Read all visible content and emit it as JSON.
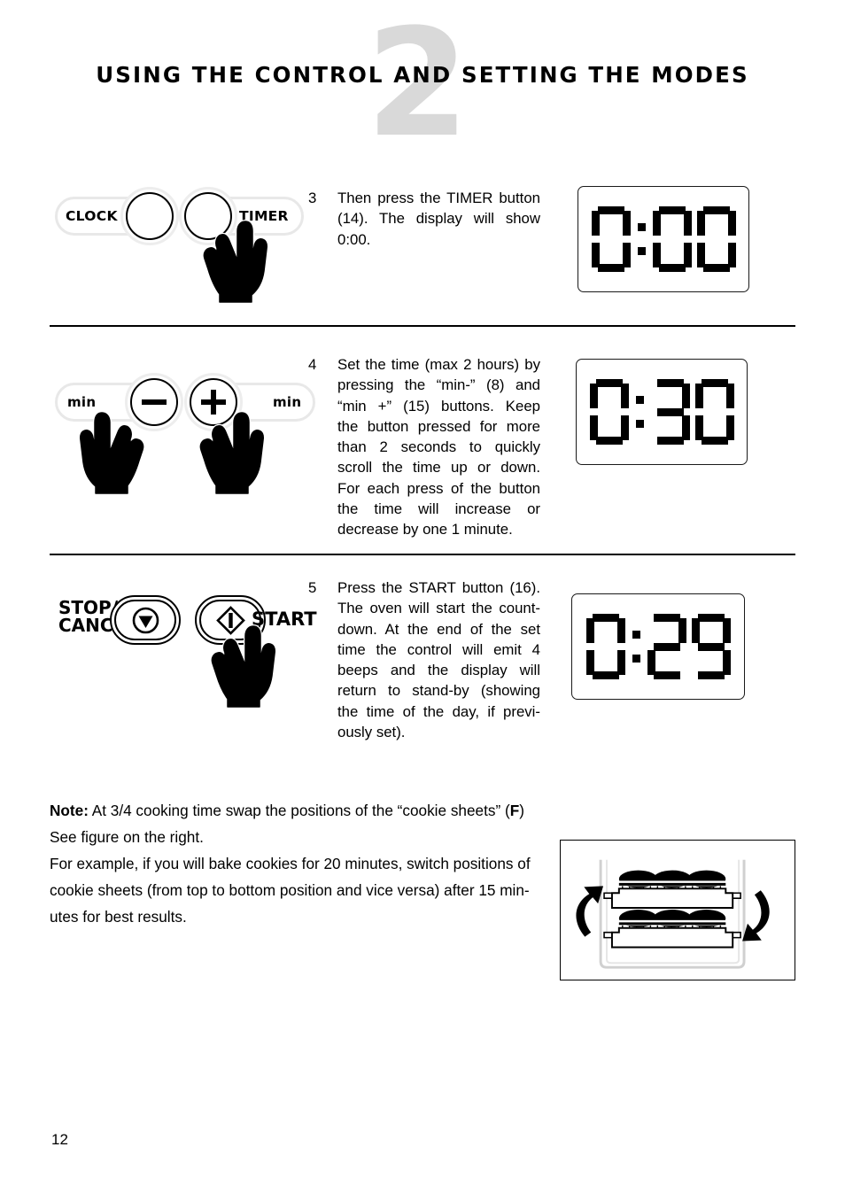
{
  "page": {
    "chapter_number": "2",
    "title": "USING THE CONTROL AND SETTING THE MODES",
    "page_number": "12"
  },
  "steps": [
    {
      "number": "3",
      "lines": [
        "Then press the TIMER button",
        "(14). The display will show",
        "0:00."
      ],
      "display": "0:00",
      "controls": {
        "left_label": "CLOCK",
        "right_label": "TIMER"
      }
    },
    {
      "number": "4",
      "lines": [
        "Set the time (max 2 hours) by",
        "pressing the “min-” (8) and",
        "“min +” (15) buttons. Keep",
        "the button pressed for more",
        "than 2 seconds to quickly",
        "scroll the time up or down.",
        "For each press of the button",
        "the time will increase or",
        "decrease by one 1 minute."
      ],
      "display": "0:30",
      "controls": {
        "left_label": "min",
        "left_glyph": "minus-icon",
        "right_label": "min",
        "right_glyph": "plus-icon"
      }
    },
    {
      "number": "5",
      "lines": [
        "Press the START button (16).",
        "The oven will start the count-",
        "down. At the end of the set",
        "time the control will emit 4",
        "beeps and the display will",
        "return to stand-by (showing",
        "the time of the day, if previ-",
        "ously set)."
      ],
      "display": "0:29",
      "controls": {
        "left_label_line1": "STOP/",
        "left_label_line2": "CANCEL",
        "left_glyph": "stop-triangle-icon",
        "right_label": "START",
        "right_glyph": "start-diamond-icon"
      }
    }
  ],
  "note": {
    "label": "Note:",
    "line1_rest": " At 3/4 cooking time swap the positions of the “cookie sheets” (",
    "bold_ref": "F",
    "line1_close": ")",
    "line2": "See figure on the right.",
    "paragraph": "For example, if you will bake cookies for 20 minutes, switch positions of cookie sheets (from top to bottom position and vice versa) after 15 min-utes for best results.",
    "paragraph_lines": [
      "For example, if you will bake cookies for 20 minutes, switch positions of",
      "cookie sheets (from top to bottom position and vice versa) after 15 min-",
      "utes for best results."
    ]
  },
  "figure": {
    "name": "oven-rack-swap-diagram",
    "cookie_count_per_sheet": 3,
    "sheet_count": 2,
    "arrows": [
      "arrow-up-left",
      "arrow-down-right"
    ]
  },
  "colors": {
    "chapter_number": "#d9d9d9",
    "text": "#000000",
    "pill_outline": "#e8e8e8",
    "background": "#ffffff"
  }
}
